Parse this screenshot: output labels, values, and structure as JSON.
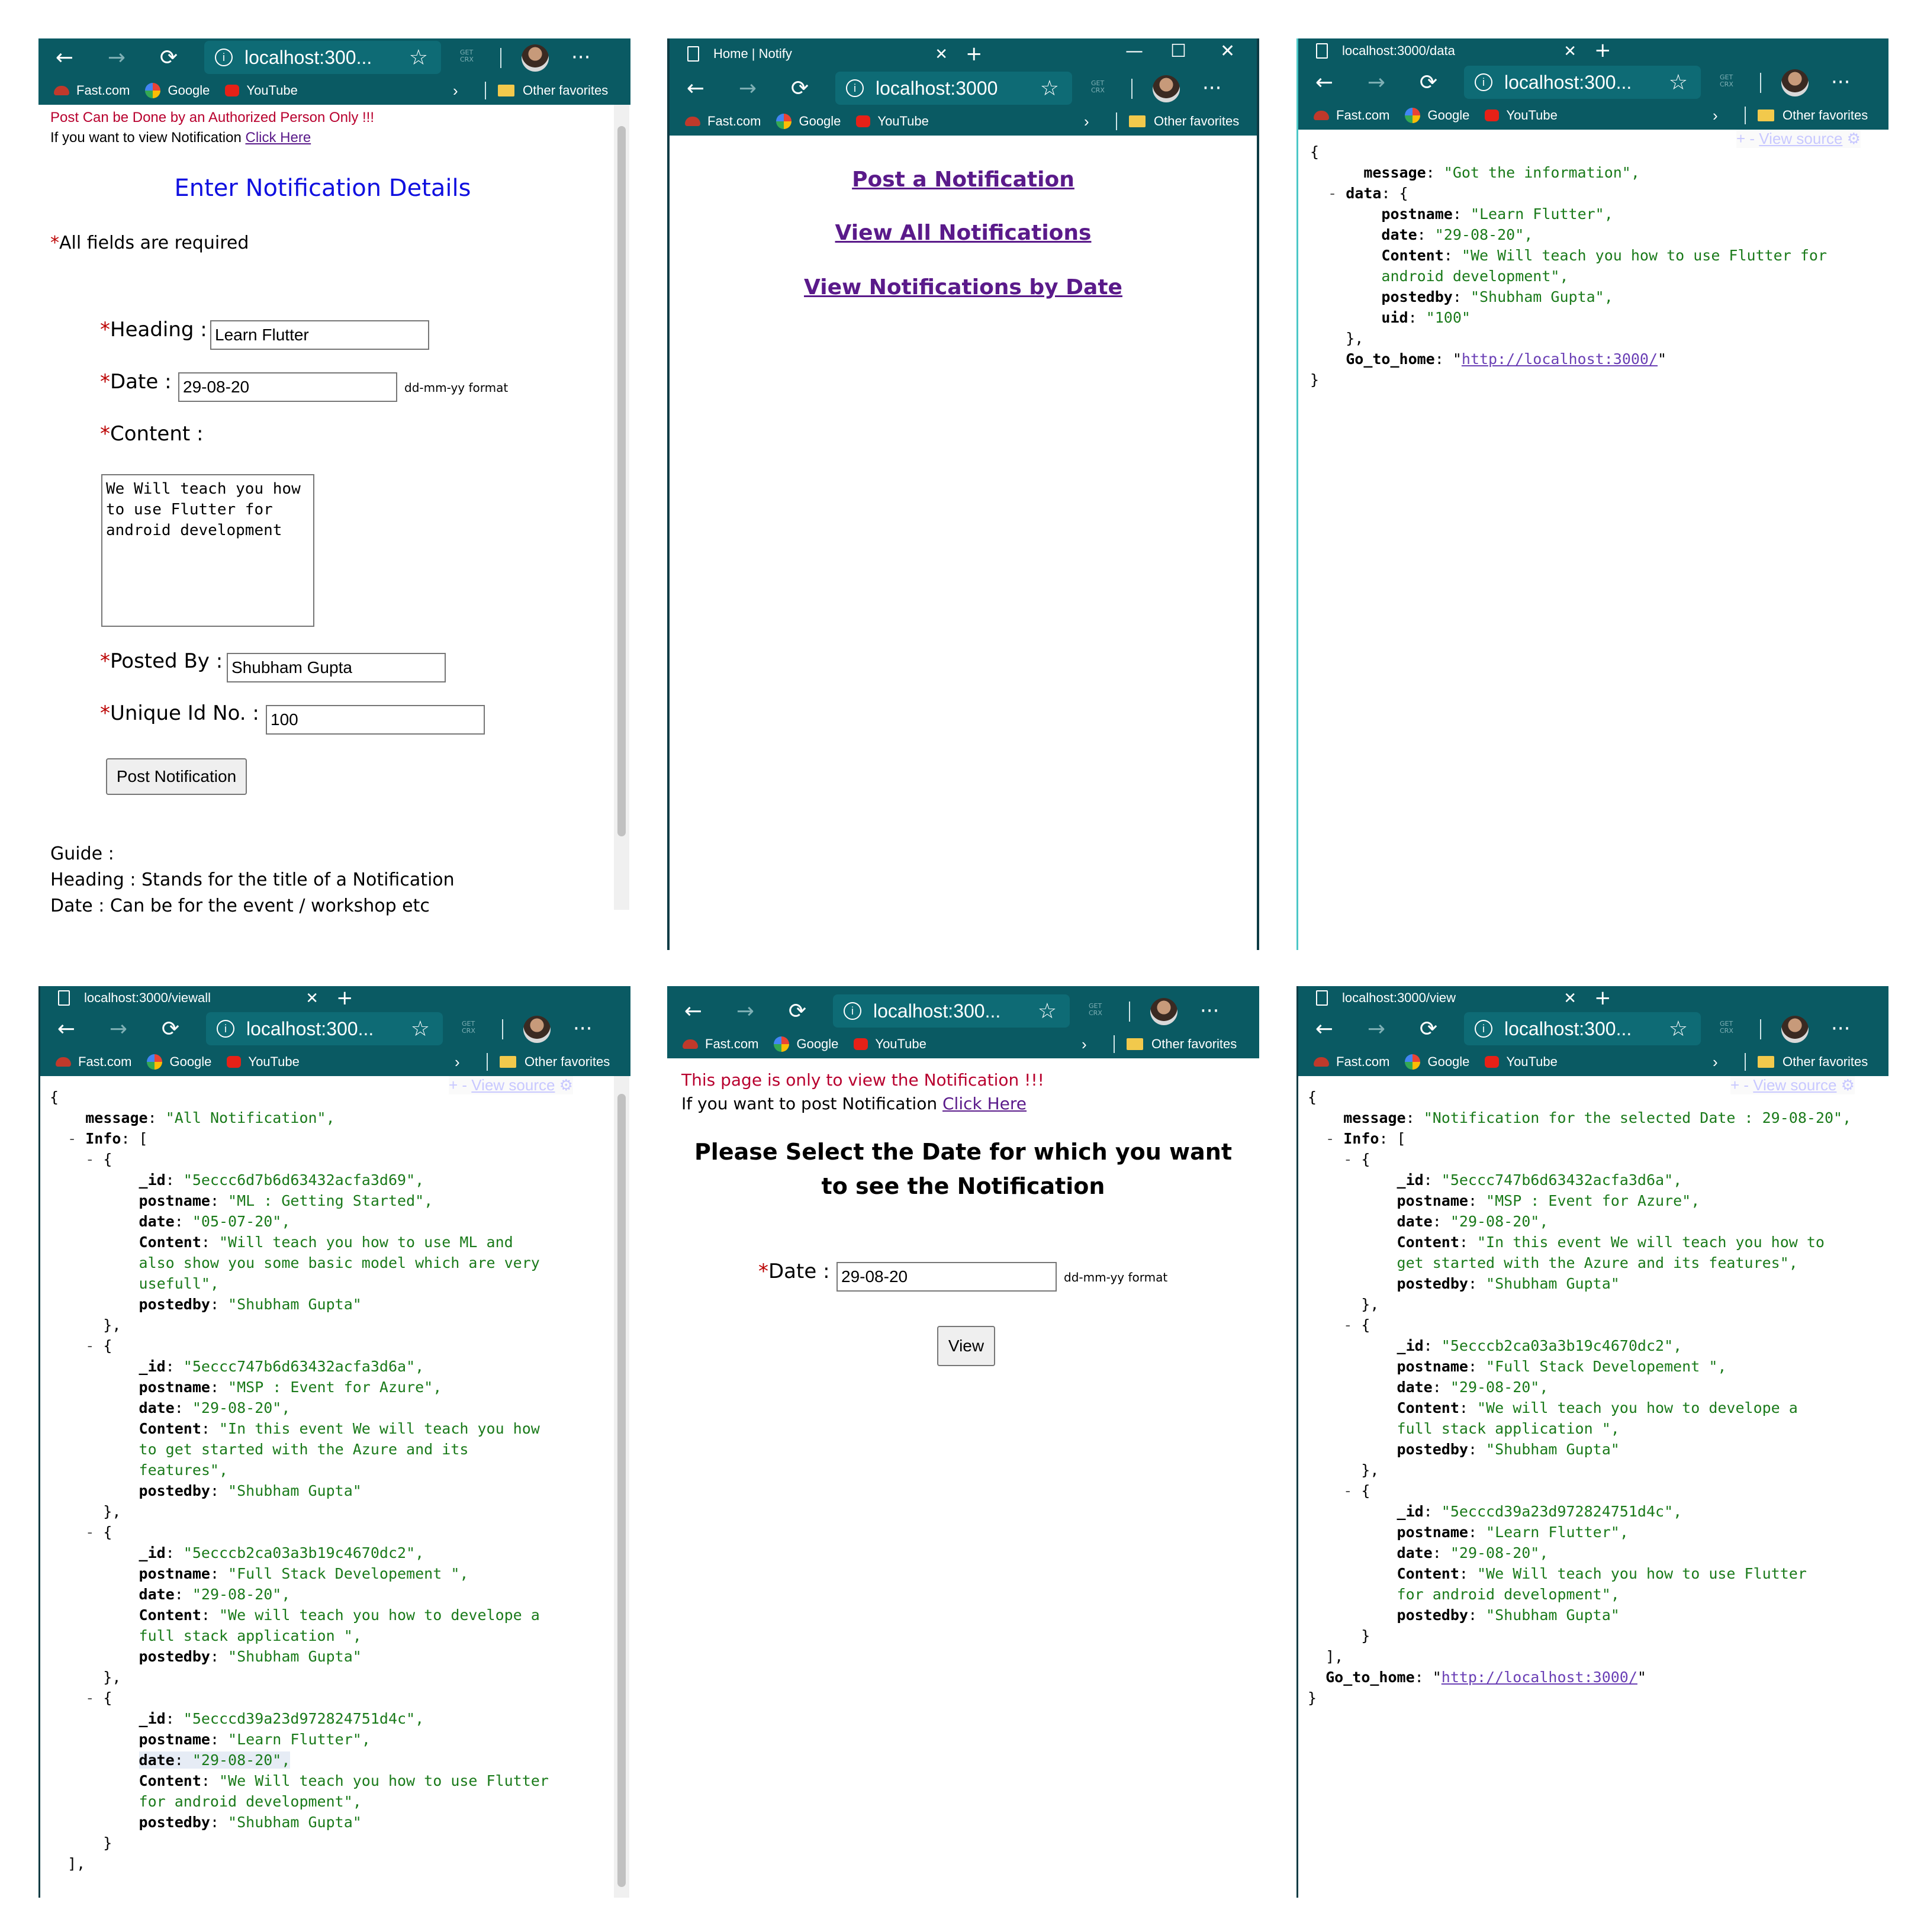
{
  "browser": {
    "bookmarks": [
      "Fast.com",
      "Google",
      "YouTube"
    ],
    "other_favorites": "Other favorites",
    "crx": "GET\nCRX"
  },
  "panels": {
    "post": {
      "address": "localhost:300...",
      "warning": "Post Can be Done by an Authorized Person Only !!!",
      "view_prompt": "If you want to view Notification ",
      "view_link": "Click Here",
      "title": "Enter Notification Details",
      "required_note": "All fields are required",
      "heading_label": "Heading :",
      "heading_value": "Learn Flutter",
      "date_label": "Date :",
      "date_value": "29-08-20",
      "date_hint": "dd-mm-yy format",
      "content_label": "Content :",
      "content_value": "We Will teach you how\nto use Flutter for\nandroid development",
      "postedby_label": "Posted By :",
      "postedby_value": "Shubham Gupta",
      "uid_label": "Unique Id No. :",
      "uid_value": "100",
      "submit": "Post Notification",
      "guide_title": "Guide :",
      "guide_heading": "Heading : Stands for the title of a Notification",
      "guide_date": "Date : Can be for the event / workshop etc"
    },
    "home": {
      "tab_title": "Home | Notify",
      "address": "localhost:3000",
      "link1": "Post a Notification",
      "link2": "View All Notifications",
      "link3": "View Notifications by Date"
    },
    "data": {
      "tab_title": "localhost:3000/data",
      "address": "localhost:300...",
      "view_source": "View source",
      "message": "\"Got the information\",",
      "postname": "\"Learn Flutter\",",
      "date": "\"29-08-20\",",
      "content1": "\"We Will teach you how to use Flutter for",
      "content2": "android development\",",
      "postedby": "\"Shubham Gupta\",",
      "uid": "\"100\"",
      "home_link": "http://localhost:3000/"
    },
    "viewall": {
      "tab_title": "localhost:3000/viewall",
      "address": "localhost:300...",
      "view_source": "View source",
      "message": "\"All Notification\",",
      "items": [
        {
          "id": "\"5eccc6d7b6d63432acfa3d69\",",
          "postname": "\"ML : Getting Started\",",
          "date": "\"05-07-20\",",
          "content": [
            "\"Will teach you how to use ML and",
            "also show you some basic model which are very",
            "usefull\","
          ],
          "postedby": "\"Shubham Gupta\""
        },
        {
          "id": "\"5eccc747b6d63432acfa3d6a\",",
          "postname": "\"MSP : Event for Azure\",",
          "date": "\"29-08-20\",",
          "content": [
            "\"In this event We will teach you how",
            "to get started with the Azure and its",
            "features\","
          ],
          "postedby": "\"Shubham Gupta\""
        },
        {
          "id": "\"5ecccb2ca03a3b19c4670dc2\",",
          "postname": "\"Full Stack Developement \",",
          "date": "\"29-08-20\",",
          "content": [
            "\"We will teach you how to develope a",
            "full stack application \","
          ],
          "postedby": "\"Shubham Gupta\""
        },
        {
          "id": "\"5ecccd39a23d972824751d4c\",",
          "postname": "\"Learn Flutter\",",
          "date": "\"29-08-20\",",
          "content": [
            "\"We Will teach you how to use Flutter",
            "for android development\","
          ],
          "postedby": "\"Shubham Gupta\""
        }
      ]
    },
    "bydate": {
      "address": "localhost:300...",
      "notice": "This page is only to view the Notification !!!",
      "post_prompt": "If you want to post Notification ",
      "post_link": "Click Here",
      "title1": "Please Select the Date for which you want",
      "title2": "to see the Notification",
      "date_label": "Date :",
      "date_value": "29-08-20",
      "date_hint": "dd-mm-yy format",
      "button": "View"
    },
    "view": {
      "tab_title": "localhost:3000/view",
      "address": "localhost:300...",
      "view_source": "View source",
      "message": "\"Notification for the selected Date : 29-08-20\",",
      "items": [
        {
          "id": "\"5eccc747b6d63432acfa3d6a\",",
          "postname": "\"MSP : Event for Azure\",",
          "date": "\"29-08-20\",",
          "content": [
            "\"In this event We will teach you how to",
            "get started with the Azure and its features\","
          ],
          "postedby": "\"Shubham Gupta\""
        },
        {
          "id": "\"5ecccb2ca03a3b19c4670dc2\",",
          "postname": "\"Full Stack Developement \",",
          "date": "\"29-08-20\",",
          "content": [
            "\"We will teach you how to develope a",
            "full stack application \","
          ],
          "postedby": "\"Shubham Gupta\""
        },
        {
          "id": "\"5ecccd39a23d972824751d4c\",",
          "postname": "\"Learn Flutter\",",
          "date": "\"29-08-20\",",
          "content": [
            "\"We Will teach you how to use Flutter",
            "for android development\","
          ],
          "postedby": "\"Shubham Gupta\""
        }
      ],
      "home_link": "http://localhost:3000/"
    }
  }
}
